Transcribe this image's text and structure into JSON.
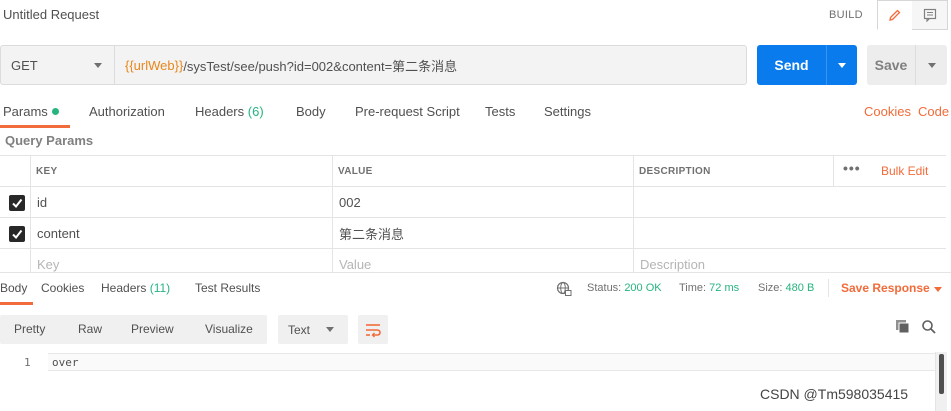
{
  "header": {
    "title": "Untitled Request",
    "build_label": "BUILD"
  },
  "request": {
    "method": "GET",
    "url_variable": "{{urlWeb}}",
    "url_path": "/sysTest/see/push?id=002&content=第二条消息",
    "send_label": "Send",
    "save_label": "Save"
  },
  "request_tabs": {
    "params": "Params",
    "authorization": "Authorization",
    "headers": "Headers",
    "headers_count": "(6)",
    "body": "Body",
    "pre_request": "Pre-request Script",
    "tests": "Tests",
    "settings": "Settings",
    "cookies": "Cookies",
    "code": "Code"
  },
  "query_params": {
    "title": "Query Params",
    "columns": [
      "KEY",
      "VALUE",
      "DESCRIPTION"
    ],
    "more": "•••",
    "bulk_edit": "Bulk Edit",
    "rows": [
      {
        "key": "id",
        "value": "002",
        "description": "",
        "checked": true
      },
      {
        "key": "content",
        "value": "第二条消息",
        "description": "",
        "checked": true
      }
    ],
    "placeholders": {
      "key": "Key",
      "value": "Value",
      "description": "Description"
    }
  },
  "response_tabs": {
    "body": "Body",
    "cookies": "Cookies",
    "headers": "Headers",
    "headers_count": "(11)",
    "test_results": "Test Results"
  },
  "response_status": {
    "status_label": "Status:",
    "status_value": "200 OK",
    "time_label": "Time:",
    "time_value": "72 ms",
    "size_label": "Size:",
    "size_value": "480 B",
    "save_response": "Save Response"
  },
  "format_toolbar": {
    "pretty": "Pretty",
    "raw": "Raw",
    "preview": "Preview",
    "visualize": "Visualize",
    "type": "Text"
  },
  "response_body": {
    "lines": [
      {
        "number": "1",
        "text": "over"
      }
    ]
  },
  "watermark": "CSDN @Tm598035415",
  "colors": {
    "accent_orange": "#f26b3a",
    "send_blue": "#097bed",
    "success_green": "#26b47f",
    "variable_orange": "#e8871a"
  }
}
